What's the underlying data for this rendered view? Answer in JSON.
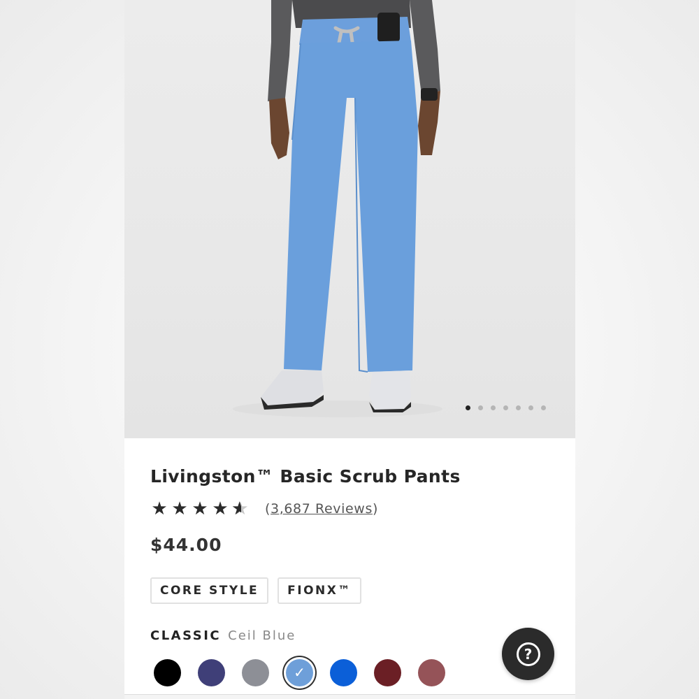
{
  "product": {
    "title": "Livingston™ Basic Scrub Pants",
    "rating": 4.5,
    "stars_max": 5,
    "reviews_text": "3,687 Reviews",
    "price": "$44.00"
  },
  "gallery": {
    "image": "product-photo",
    "dots_count": 7,
    "active_index": 0
  },
  "tags": [
    "CORE STYLE",
    "FIONX™"
  ],
  "color": {
    "collection_label": "CLASSIC",
    "selected_name": "Ceil Blue",
    "swatches": [
      {
        "hex": "#000000"
      },
      {
        "hex": "#3f3f78"
      },
      {
        "hex": "#8d8f96"
      },
      {
        "hex": "#6e9fd9",
        "selected": true
      },
      {
        "hex": "#0b5fd8"
      },
      {
        "hex": "#6b1f25"
      },
      {
        "hex": "#955358"
      }
    ]
  },
  "help_button": {
    "icon": "question-mark-icon"
  },
  "colors": {
    "pants": "#6a9fdc",
    "text_dark": "#262626",
    "help_bg": "#2b2b2b"
  }
}
